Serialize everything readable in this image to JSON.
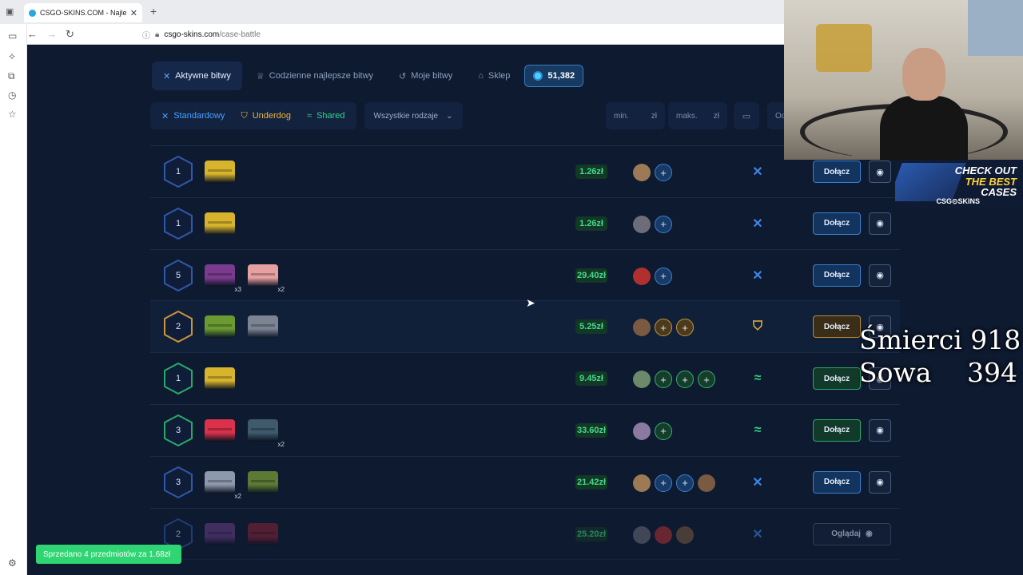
{
  "browser": {
    "tab_title": "CSGO-SKINS.COM - Najlepsze",
    "url_host": "csgo-skins.com",
    "url_path": "/case-battle"
  },
  "nav": {
    "items": [
      {
        "label": "Aktywne bitwy",
        "icon": "swords-icon",
        "active": true
      },
      {
        "label": "Codzienne najlepsze bitwy",
        "icon": "trophy-icon",
        "active": false
      },
      {
        "label": "Moje bitwy",
        "icon": "history-icon",
        "active": false
      },
      {
        "label": "Sklep",
        "icon": "basket-icon",
        "active": false
      }
    ],
    "balance": "51,382"
  },
  "filters": {
    "types": [
      {
        "label": "Standardowy",
        "icon": "swords-icon"
      },
      {
        "label": "Underdog",
        "icon": "shield-icon"
      },
      {
        "label": "Shared",
        "icon": "handshake-icon"
      }
    ],
    "all_kinds": "Wszystkie rodzaje",
    "min_label": "min.",
    "max_label": "maks.",
    "currency": "zł",
    "sort_partial": "Od"
  },
  "battles": [
    {
      "round": "1",
      "mode": "standard",
      "price": "1.26zł",
      "cases": [
        {
          "color": "#d7b42c"
        }
      ],
      "players": [
        "avatar",
        "plus"
      ],
      "action": "Dołącz"
    },
    {
      "round": "1",
      "mode": "standard",
      "price": "1.26zł",
      "cases": [
        {
          "color": "#d7b42c"
        }
      ],
      "players": [
        "avatar",
        "plus"
      ],
      "action": "Dołącz"
    },
    {
      "round": "5",
      "mode": "standard",
      "price": "29.40zł",
      "cases": [
        {
          "color": "#7a3b8e",
          "mult": "x3"
        },
        {
          "color": "#e6a0a0",
          "mult": "x2"
        }
      ],
      "players": [
        "avatar",
        "plus"
      ],
      "action": "Dołącz"
    },
    {
      "round": "2",
      "mode": "underdog",
      "price": "5.25zł",
      "cases": [
        {
          "color": "#6a9a30"
        },
        {
          "color": "#7c8494"
        }
      ],
      "players": [
        "avatar",
        "plus",
        "plus"
      ],
      "action": "Dołącz"
    },
    {
      "round": "1",
      "mode": "shared",
      "price": "9.45zł",
      "cases": [
        {
          "color": "#d7b42c"
        }
      ],
      "players": [
        "avatar",
        "plus",
        "plus",
        "plus"
      ],
      "action": "Dołącz"
    },
    {
      "round": "3",
      "mode": "shared",
      "price": "33.60zł",
      "cases": [
        {
          "color": "#d9324a"
        },
        {
          "color": "#3e5a6c",
          "mult": "x2"
        }
      ],
      "players": [
        "avatar",
        "plus"
      ],
      "action": "Dołącz"
    },
    {
      "round": "3",
      "mode": "standard",
      "price": "21.42zł",
      "cases": [
        {
          "color": "#8d98ac",
          "mult": "x2"
        },
        {
          "color": "#5d7a34"
        }
      ],
      "players": [
        "avatar",
        "plus",
        "plus",
        "avatar"
      ],
      "action": "Dołącz"
    },
    {
      "round": "2",
      "mode": "standard",
      "price": "25.20zł",
      "cases": [
        {
          "color": "#6b3f8a"
        },
        {
          "color": "#8a2236"
        }
      ],
      "players": [
        "avatar",
        "avatar",
        "avatar"
      ],
      "action": "Oglądaj"
    }
  ],
  "toast": "Sprzedano 4 przedmiotów za 1.68zł",
  "overlay": {
    "promo_line1": "CHECK OUT",
    "promo_line2": "THE BEST",
    "promo_line3": "CASES",
    "promo_brand": "CSG⊙SKINS",
    "deaths_label": "Śmierci",
    "deaths_value": "918",
    "owl_label": "Sowa",
    "owl_value": "394"
  }
}
